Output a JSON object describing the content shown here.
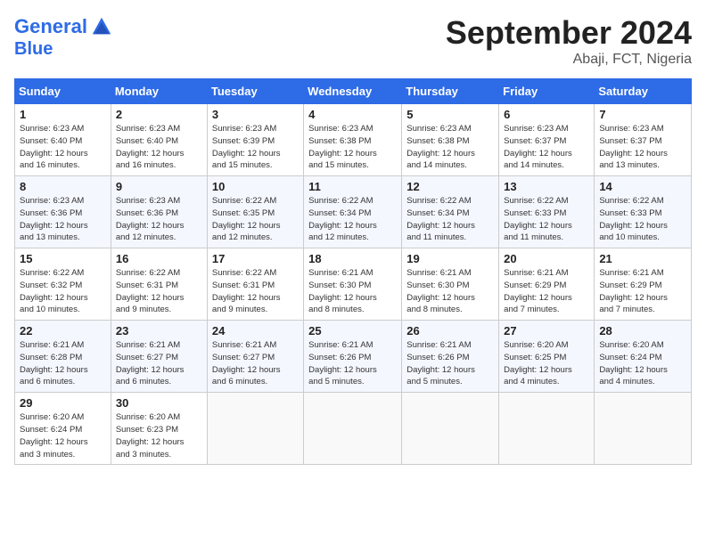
{
  "header": {
    "logo_line1": "General",
    "logo_line2": "Blue",
    "month": "September 2024",
    "location": "Abaji, FCT, Nigeria"
  },
  "weekdays": [
    "Sunday",
    "Monday",
    "Tuesday",
    "Wednesday",
    "Thursday",
    "Friday",
    "Saturday"
  ],
  "weeks": [
    [
      {
        "day": "1",
        "info": "Sunrise: 6:23 AM\nSunset: 6:40 PM\nDaylight: 12 hours\nand 16 minutes."
      },
      {
        "day": "2",
        "info": "Sunrise: 6:23 AM\nSunset: 6:40 PM\nDaylight: 12 hours\nand 16 minutes."
      },
      {
        "day": "3",
        "info": "Sunrise: 6:23 AM\nSunset: 6:39 PM\nDaylight: 12 hours\nand 15 minutes."
      },
      {
        "day": "4",
        "info": "Sunrise: 6:23 AM\nSunset: 6:38 PM\nDaylight: 12 hours\nand 15 minutes."
      },
      {
        "day": "5",
        "info": "Sunrise: 6:23 AM\nSunset: 6:38 PM\nDaylight: 12 hours\nand 14 minutes."
      },
      {
        "day": "6",
        "info": "Sunrise: 6:23 AM\nSunset: 6:37 PM\nDaylight: 12 hours\nand 14 minutes."
      },
      {
        "day": "7",
        "info": "Sunrise: 6:23 AM\nSunset: 6:37 PM\nDaylight: 12 hours\nand 13 minutes."
      }
    ],
    [
      {
        "day": "8",
        "info": "Sunrise: 6:23 AM\nSunset: 6:36 PM\nDaylight: 12 hours\nand 13 minutes."
      },
      {
        "day": "9",
        "info": "Sunrise: 6:23 AM\nSunset: 6:36 PM\nDaylight: 12 hours\nand 12 minutes."
      },
      {
        "day": "10",
        "info": "Sunrise: 6:22 AM\nSunset: 6:35 PM\nDaylight: 12 hours\nand 12 minutes."
      },
      {
        "day": "11",
        "info": "Sunrise: 6:22 AM\nSunset: 6:34 PM\nDaylight: 12 hours\nand 12 minutes."
      },
      {
        "day": "12",
        "info": "Sunrise: 6:22 AM\nSunset: 6:34 PM\nDaylight: 12 hours\nand 11 minutes."
      },
      {
        "day": "13",
        "info": "Sunrise: 6:22 AM\nSunset: 6:33 PM\nDaylight: 12 hours\nand 11 minutes."
      },
      {
        "day": "14",
        "info": "Sunrise: 6:22 AM\nSunset: 6:33 PM\nDaylight: 12 hours\nand 10 minutes."
      }
    ],
    [
      {
        "day": "15",
        "info": "Sunrise: 6:22 AM\nSunset: 6:32 PM\nDaylight: 12 hours\nand 10 minutes."
      },
      {
        "day": "16",
        "info": "Sunrise: 6:22 AM\nSunset: 6:31 PM\nDaylight: 12 hours\nand 9 minutes."
      },
      {
        "day": "17",
        "info": "Sunrise: 6:22 AM\nSunset: 6:31 PM\nDaylight: 12 hours\nand 9 minutes."
      },
      {
        "day": "18",
        "info": "Sunrise: 6:21 AM\nSunset: 6:30 PM\nDaylight: 12 hours\nand 8 minutes."
      },
      {
        "day": "19",
        "info": "Sunrise: 6:21 AM\nSunset: 6:30 PM\nDaylight: 12 hours\nand 8 minutes."
      },
      {
        "day": "20",
        "info": "Sunrise: 6:21 AM\nSunset: 6:29 PM\nDaylight: 12 hours\nand 7 minutes."
      },
      {
        "day": "21",
        "info": "Sunrise: 6:21 AM\nSunset: 6:29 PM\nDaylight: 12 hours\nand 7 minutes."
      }
    ],
    [
      {
        "day": "22",
        "info": "Sunrise: 6:21 AM\nSunset: 6:28 PM\nDaylight: 12 hours\nand 6 minutes."
      },
      {
        "day": "23",
        "info": "Sunrise: 6:21 AM\nSunset: 6:27 PM\nDaylight: 12 hours\nand 6 minutes."
      },
      {
        "day": "24",
        "info": "Sunrise: 6:21 AM\nSunset: 6:27 PM\nDaylight: 12 hours\nand 6 minutes."
      },
      {
        "day": "25",
        "info": "Sunrise: 6:21 AM\nSunset: 6:26 PM\nDaylight: 12 hours\nand 5 minutes."
      },
      {
        "day": "26",
        "info": "Sunrise: 6:21 AM\nSunset: 6:26 PM\nDaylight: 12 hours\nand 5 minutes."
      },
      {
        "day": "27",
        "info": "Sunrise: 6:20 AM\nSunset: 6:25 PM\nDaylight: 12 hours\nand 4 minutes."
      },
      {
        "day": "28",
        "info": "Sunrise: 6:20 AM\nSunset: 6:24 PM\nDaylight: 12 hours\nand 4 minutes."
      }
    ],
    [
      {
        "day": "29",
        "info": "Sunrise: 6:20 AM\nSunset: 6:24 PM\nDaylight: 12 hours\nand 3 minutes."
      },
      {
        "day": "30",
        "info": "Sunrise: 6:20 AM\nSunset: 6:23 PM\nDaylight: 12 hours\nand 3 minutes."
      },
      {
        "day": "",
        "info": ""
      },
      {
        "day": "",
        "info": ""
      },
      {
        "day": "",
        "info": ""
      },
      {
        "day": "",
        "info": ""
      },
      {
        "day": "",
        "info": ""
      }
    ]
  ]
}
